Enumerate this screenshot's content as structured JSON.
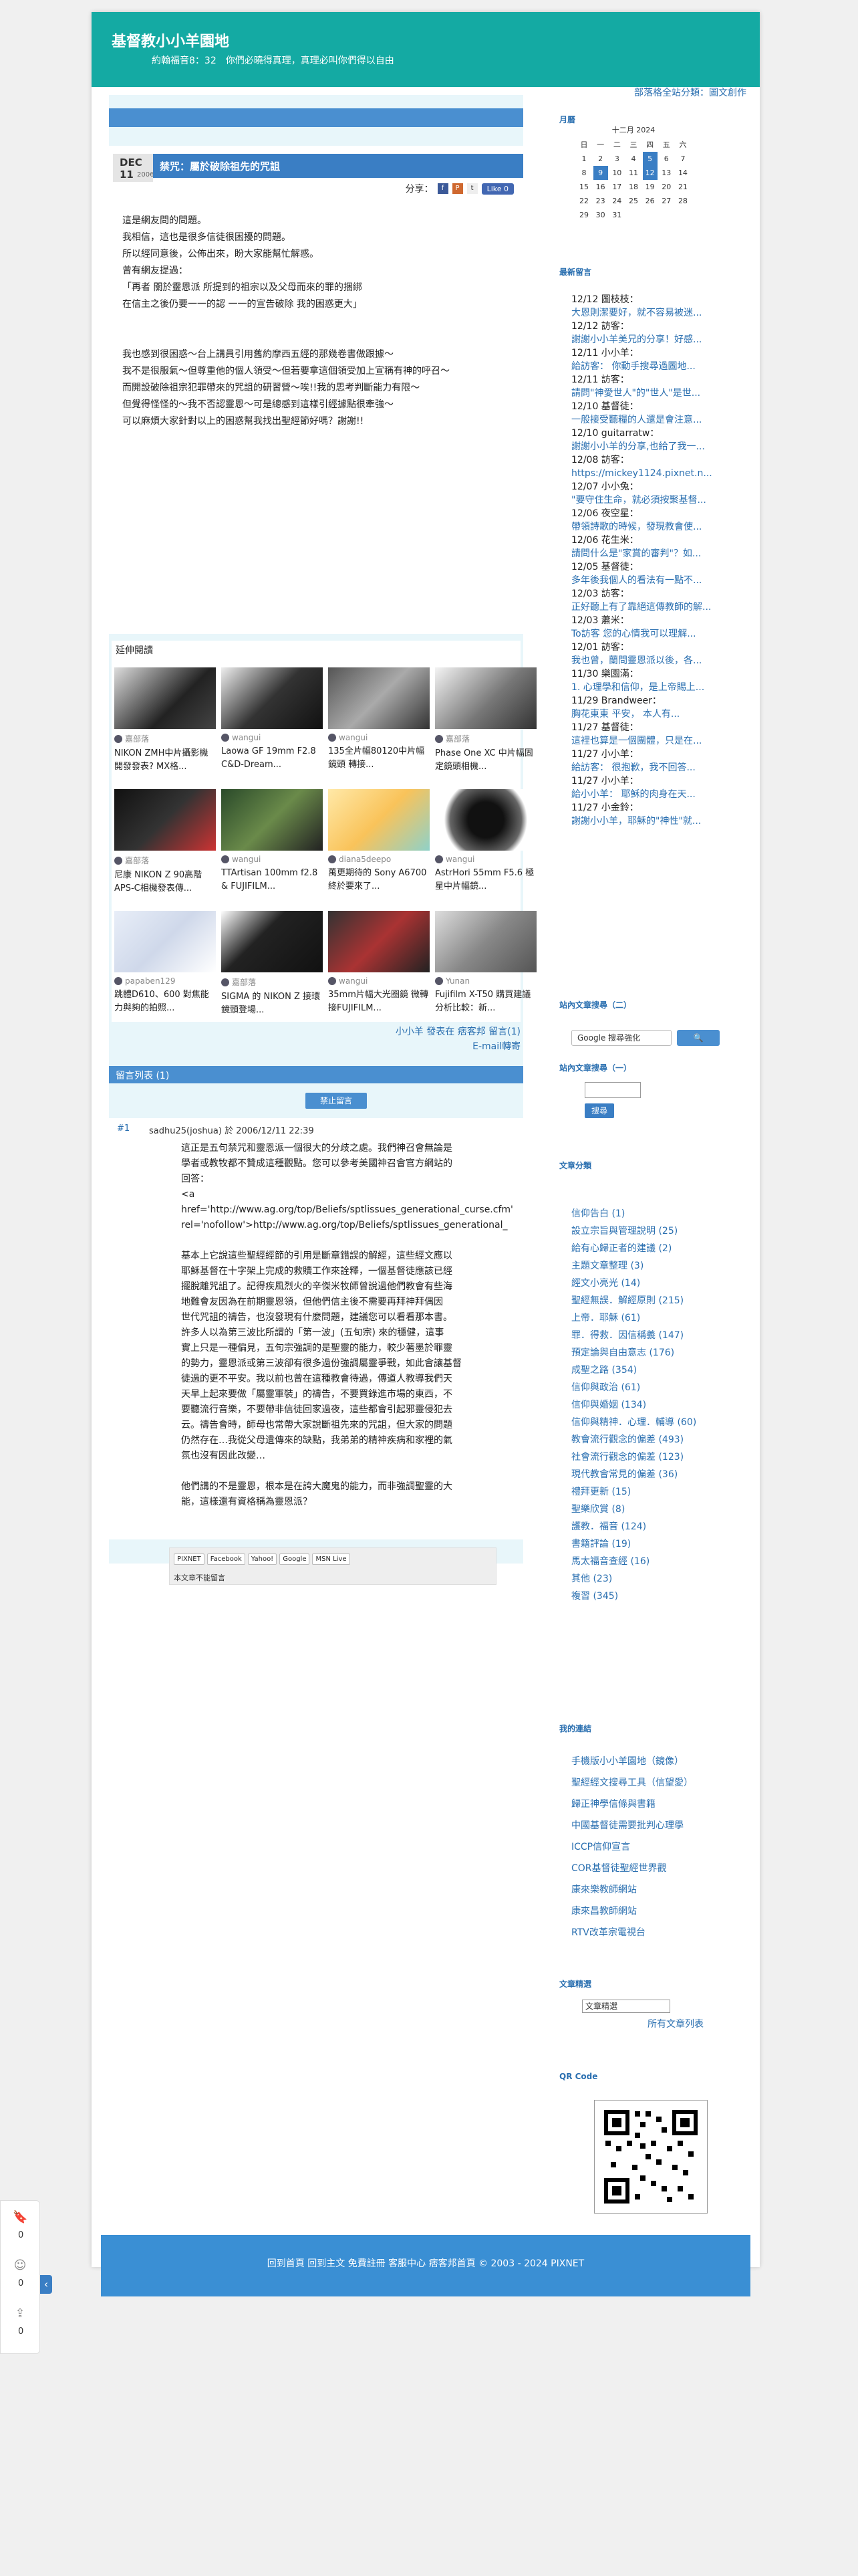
{
  "blog": {
    "title": "基督教小小羊園地",
    "description": "約翰福音8：32　你們必曉得真理，真理必叫你們得以自由",
    "sub_link": "部落格全站分類：圖文創作"
  },
  "post": {
    "date_month": "DEC",
    "date_day": "11",
    "date_year": "2006",
    "title": "禁咒：屬於破除祖先的咒詛",
    "share_label": "分享：",
    "like_label": "Like 0",
    "body": [
      "這是網友問的問題。",
      "我相信，這也是很多信徒很困擾的問題。",
      "所以經同意後，公佈出來，盼大家能幫忙解惑。",
      "曾有網友提過：",
      "「再者 關於靈恩派 所提到的祖宗以及父母而來的罪的捆綁",
      "在信主之後仍要一一的認 一一的宣告破除 我的困惑更大」",
      "",
      "",
      "我也感到很困惑～台上講員引用舊約摩西五經的那幾卷書做跟據～",
      "我不是很服氣～但尊重他的個人領受～但若要拿這個領受加上宣稱有神的呼召～",
      "而開設破除祖宗犯罪帶來的咒詛的研習營～唉!!我的思考判斷能力有限～",
      "但覺得怪怪的～我不否認靈恩～可是總感到這樣引經據點很牽強～",
      "可以麻煩大家針對以上的困惑幫我找出聖經節好嗎？謝謝!!"
    ]
  },
  "related": {
    "title": "延伸閱讀",
    "items": [
      {
        "author": "嘉部落",
        "text": "NIKON ZMH中片攝影機開發發表? MX格..."
      },
      {
        "author": "wangui",
        "text": "Laowa GF 19mm F2.8 C&D-Dream..."
      },
      {
        "author": "wangui",
        "text": "135全片幅80120中片幅鏡頭 轉接..."
      },
      {
        "author": "嘉部落",
        "text": "Phase One XC 中片幅固定鏡頭相機..."
      },
      {
        "author": "嘉部落",
        "text": "尼康 NIKON Z 90高階APS-C相機發表傳..."
      },
      {
        "author": "wangui",
        "text": "TTArtisan 100mm f2.8 & FUJIFILM..."
      },
      {
        "author": "diana5deepo",
        "text": "萬更期待的 Sony A6700 終於要來了..."
      },
      {
        "author": "wangui",
        "text": "AstrHori 55mm F5.6 極星中片幅鏡..."
      },
      {
        "author": "papaben129",
        "text": "跳體D610、600 對焦能力與夠的拍照..."
      },
      {
        "author": "嘉部落",
        "text": "SIGMA 的 NIKON Z 接環鏡頭登場..."
      },
      {
        "author": "wangui",
        "text": "35mm片幅大光圈鏡 微轉接FUJIFILM..."
      },
      {
        "author": "Yunan",
        "text": "Fujifilm X-T50 購買建議分析比較：新..."
      }
    ]
  },
  "post_footer": {
    "line1": "小小羊 發表在 痞客邦 留言(1)",
    "line2": "E-mail轉寄"
  },
  "comments": {
    "header": "留言列表 (1)",
    "disable_btn": "禁止留言",
    "number": "#1",
    "author_line": "sadhu25(joshua) 於 2006/12/11 22:39",
    "body": [
      "這正是五句禁咒和靈恩派一個很大的分歧之處。我們神召會無論是",
      "學者或教牧都不贊成這種觀點。您可以參考美國神召會官方網站的",
      "回答：",
      "<a",
      "href='http://www.ag.org/top/Beliefs/sptlissues_generational_curse.cfm'",
      "rel='nofollow'>http://www.ag.org/top/Beliefs/sptlissues_generational_",
      "",
      "基本上它說這些聖經經節的引用是斷章錯誤的解經，這些經文應以",
      "耶穌基督在十字架上完成的救贖工作來詮釋，一個基督徒應該已經",
      "擺脫離咒詛了。記得疾風烈火的辛傑米牧師曾說過他們教會有些海",
      "地難會友因為在前期靈恩領，但他們信主後不需要再拜神拜偶因",
      "世代咒詛的禱告，也沒發現有什麼問題，建議您可以看看那本書。",
      "許多人以為第三波比所謂的「第一波」(五旬宗) 來的穩健，這事",
      "實上只是一種偏見，五旬宗強調的是聖靈的能力，較少著墨於罪靈",
      "的勢力，靈恩派或第三波卻有很多過份強調屬靈爭戰，如此會讓基督",
      "徒過的更不平安。我以前也曾在這種教會待過，傳道人教導我們天",
      "天早上起來要做「屬靈軍裝」的禱告，不要買錄進市場的東西，不",
      "要聽流行音樂，不要帶非信徒回家過夜，這些都會引起邪靈侵犯去",
      "云。禱告會時，師母也常帶大家說斷祖先來的咒詛，但大家的問題",
      "仍然存在…我從父母遺傳來的缺點，我弟弟的精神疾病和家裡的氣",
      "氛也沒有因此改變…",
      "",
      "他們講的不是靈恩，根本是在誇大魔鬼的能力，而非強調聖靈的大",
      "能，這樣還有資格稱為靈恩派？"
    ]
  },
  "share_bar": {
    "links": [
      "PIXNET",
      "Facebook",
      "Yahoo!",
      "Google",
      "MSN Live"
    ],
    "note": "本文章不能留言"
  },
  "sidebar": {
    "calendar_title": "月曆",
    "calendar_month": "十二月 2024",
    "calendar_head": [
      "日",
      "一",
      "二",
      "三",
      "四",
      "五",
      "六"
    ],
    "calendar_rows": [
      [
        "1",
        "2",
        "3",
        "4",
        "5",
        "6",
        "7"
      ],
      [
        "8",
        "9",
        "10",
        "11",
        "12",
        "13",
        "14"
      ],
      [
        "15",
        "16",
        "17",
        "18",
        "19",
        "20",
        "21"
      ],
      [
        "22",
        "23",
        "24",
        "25",
        "26",
        "27",
        "28"
      ],
      [
        "29",
        "30",
        "31",
        "",
        "",
        "",
        ""
      ]
    ],
    "recent_title": "最新留言",
    "recent": [
      {
        "head": "12/12 圖枝枝：",
        "link": "大恩則潔要好，就不容易被迷..."
      },
      {
        "head": "12/12 訪客：",
        "link": "謝謝小小羊美兄的分享！好感..."
      },
      {
        "head": "12/11 小小羊：",
        "link": "給訪客： 你動手搜尋過圖地..."
      },
      {
        "head": "12/11 訪客：",
        "link": "請問\"神愛世人\"的\"世人\"是世..."
      },
      {
        "head": "12/10 基督徒：",
        "link": "一般接受聽糧的人還是會注意..."
      },
      {
        "head": "12/10 guitarratw：",
        "link": "謝謝小小羊的分享,也給了我一..."
      },
      {
        "head": "12/08 訪客：",
        "link": "https://mickey1124.pixnet.n..."
      },
      {
        "head": "12/07 小小兔：",
        "link": "\"要守住生命，就必須按聚基督..."
      },
      {
        "head": "12/06 夜空星：",
        "link": "帶領詩歌的時候，發現教會使..."
      },
      {
        "head": "12/06 花生米：",
        "link": "請問什么是\"家賞的審判\"？如..."
      },
      {
        "head": "12/05 基督徒：",
        "link": "多年後我個人的看法有一點不..."
      },
      {
        "head": "12/03 訪客：",
        "link": "正好聽上有了靠絕這傳教師的解..."
      },
      {
        "head": "12/03 蕭米：",
        "link": "To訪客 您的心情我可以理解..."
      },
      {
        "head": "12/01 訪客：",
        "link": "我也曾，蘭問靈恩派以後，各..."
      },
      {
        "head": "11/30 樂園滿：",
        "link": "1. 心理學和信仰，是上帝賜上..."
      },
      {
        "head": "11/29 Brandweer：",
        "link": "胸花東東 平安， 本人有..."
      },
      {
        "head": "11/27 基督徒：",
        "link": "這裡也算是一個團體，只是在..."
      },
      {
        "head": "11/27 小小羊：",
        "link": "給訪客： 很抱歉，我不回答..."
      },
      {
        "head": "11/27 小小羊：",
        "link": "給小小羊： 耶穌的肉身在天..."
      },
      {
        "head": "11/27 小金鈴：",
        "link": "謝謝小小羊，耶穌的\"神性\"就..."
      }
    ],
    "search_g_title": "站內文章搜尋（二）",
    "search_g_placeholder": "Google 搜尋強化",
    "search_g_btn": "🔍",
    "search_l_title": "站內文章搜尋（一）",
    "search_l_btn": "搜尋",
    "cat_title": "文章分類",
    "categories": [
      "信仰告白 (1)",
      "設立宗旨與管理說明 (25)",
      "給有心歸正者的建議 (2)",
      "主題文章整理 (3)",
      "經文小亮光 (14)",
      "聖經無誤．解經原則 (215)",
      "上帝．耶穌 (61)",
      "罪．得救．因信稱義 (147)",
      "預定論與自由意志 (176)",
      "成聖之路 (354)",
      "信仰與政治 (61)",
      "信仰與婚姻 (134)",
      "信仰與精神．心理．輔導 (60)",
      "教會流行觀念的偏差 (493)",
      "社會流行觀念的偏差 (123)",
      "現代教會常見的偏差 (36)",
      "禮拜更新 (15)",
      "聖樂欣賞 (8)",
      "護教．福音 (124)",
      "書籍評論 (19)",
      "馬太福音查經 (16)",
      "其他 (23)",
      "複習 (345)"
    ],
    "links_title": "我的連結",
    "links": [
      "手機版小小羊園地（鏡像）",
      "聖經經文搜尋工具（信望愛）",
      "歸正神學信條與書籍",
      "中國基督徒需要批判心理學",
      "ICCP信仰宣言",
      "COR基督徒聖經世界觀",
      "康來樂教師網站",
      "康來昌教師網站",
      "RTV改革宗電視台"
    ],
    "archive_title": "文章精選",
    "archive_select": "文章精選",
    "archive_link": "所有文章列表",
    "qr_title": "QR Code"
  },
  "bottom": {
    "text": "回到首頁 回到主文 免費註冊 客服中心 痞客邦首頁 © 2003 - 2024 PIXNET"
  },
  "dock": {
    "counts": [
      "0",
      "0",
      "0"
    ]
  }
}
